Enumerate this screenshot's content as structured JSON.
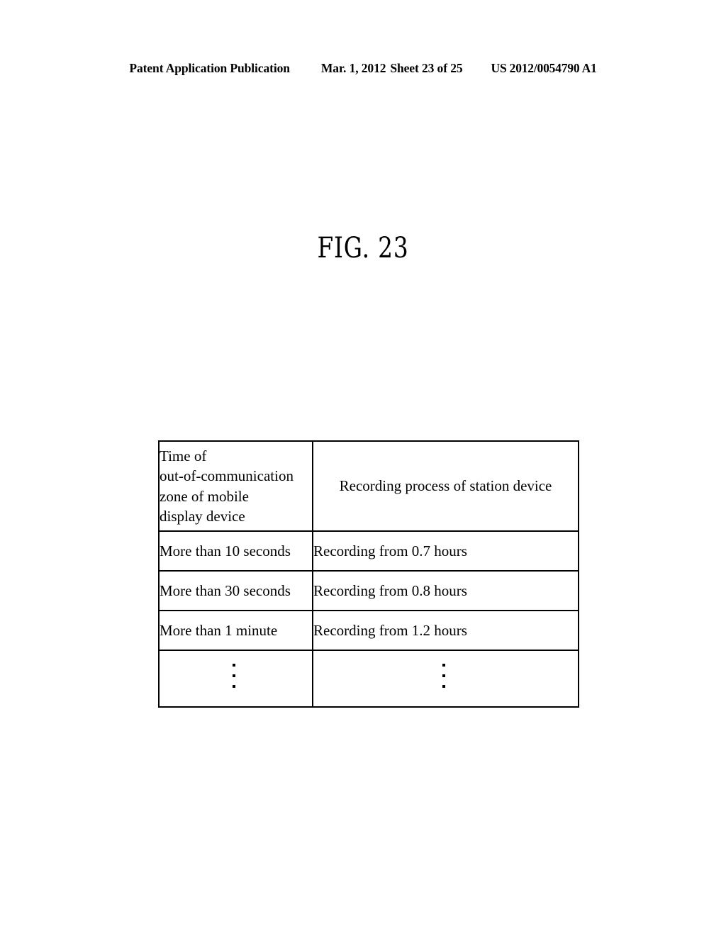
{
  "page": {
    "header": {
      "publication": "Patent Application Publication",
      "date": "Mar. 1, 2012",
      "sheet": "Sheet 23 of 25",
      "patent_number": "US 2012/0054790 A1"
    },
    "figure_label": "FIG. 23"
  },
  "table": {
    "headers": [
      "Time of\nout-of-communication\nzone of mobile\ndisplay device",
      "Recording process of station device"
    ],
    "header_left_lines": [
      "Time of",
      "out-of-communication",
      "zone of mobile",
      "display device"
    ],
    "rows": [
      {
        "condition": "More than 10 seconds",
        "process": "Recording from 0.7 hours"
      },
      {
        "condition": "More than 30 seconds",
        "process": "Recording from 0.8 hours"
      },
      {
        "condition": "More than 1 minute",
        "process": "Recording from 1.2 hours"
      }
    ],
    "continuation_marker": "vertical-ellipsis"
  },
  "colors": {
    "ink": "#000000",
    "paper": "#ffffff"
  }
}
